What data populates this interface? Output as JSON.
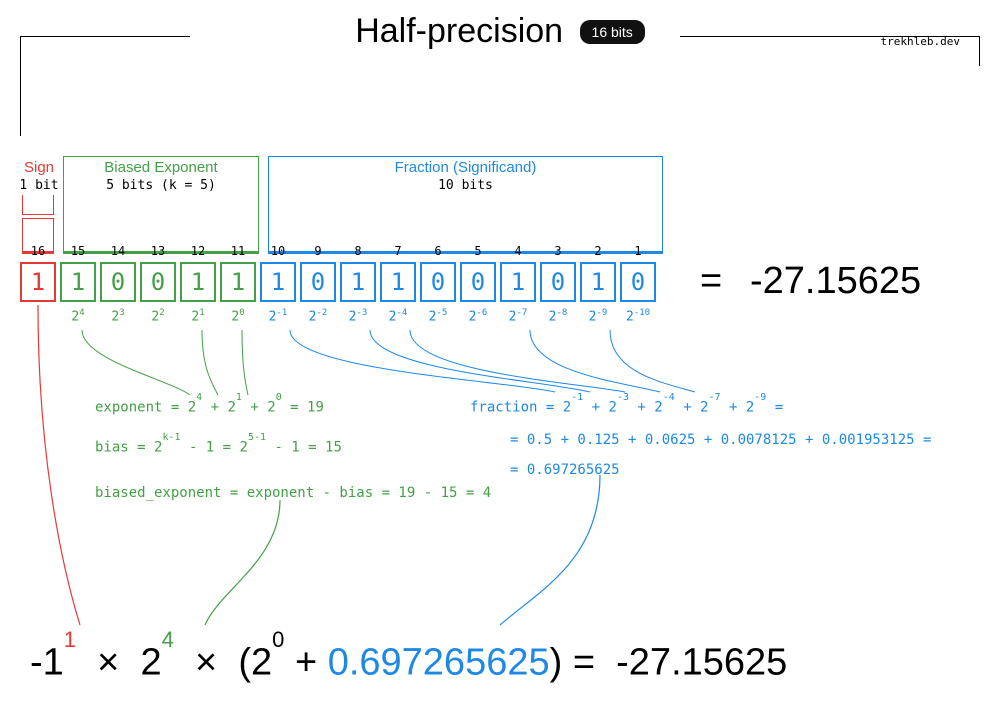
{
  "title": "Half-precision",
  "badge": "16 bits",
  "credit": "trekhleb.dev",
  "sections": {
    "sign": {
      "label": "Sign",
      "sub": "1 bit"
    },
    "exponent": {
      "label": "Biased Exponent",
      "sub": "5 bits (k = 5)"
    },
    "fraction": {
      "label": "Fraction (Significand)",
      "sub": "10 bits"
    }
  },
  "bit_indices": [
    "16",
    "15",
    "14",
    "13",
    "12",
    "11",
    "10",
    "9",
    "8",
    "7",
    "6",
    "5",
    "4",
    "3",
    "2",
    "1"
  ],
  "bits": {
    "sign": [
      "1"
    ],
    "exponent": [
      "1",
      "0",
      "0",
      "1",
      "1"
    ],
    "fraction": [
      "1",
      "0",
      "1",
      "1",
      "0",
      "0",
      "1",
      "0",
      "1",
      "0"
    ]
  },
  "powers": {
    "exponent": [
      "4",
      "3",
      "2",
      "1",
      "0"
    ],
    "fraction": [
      "-1",
      "-2",
      "-3",
      "-4",
      "-5",
      "-6",
      "-7",
      "-8",
      "-9",
      "-10"
    ]
  },
  "result_equals": "=",
  "result_value": "-27.15625",
  "exp_calc": {
    "l1_a": "exponent = 2",
    "l1_b": "+ 2",
    "l1_c": "+ 2",
    "l1_d": " = 19",
    "l1_e4": "4",
    "l1_e1": "1",
    "l1_e0": "0",
    "l2_a": "bias = 2",
    "l2_b": " - 1 = 2",
    "l2_c": " - 1 = 15",
    "l2_e1": "k-1",
    "l2_e2": "5-1",
    "l3": "biased_exponent = exponent - bias = 19 - 15 = 4"
  },
  "frac_calc": {
    "l1_a": "fraction = 2",
    "l1_b": "+ 2",
    "l1_c": "+ 2",
    "l1_d": "+ 2",
    "l1_e": "+ 2",
    "l1_f": " =",
    "e1": "-1",
    "e2": "-3",
    "e3": "-4",
    "e4": "-7",
    "e5": "-9",
    "l2": "= 0.5 + 0.125 + 0.0625 + 0.0078125 + 0.001953125 =",
    "l3": "= 0.697265625"
  },
  "formula": {
    "neg1": "-1",
    "exp1": "1",
    "times1": "×",
    "two": "2",
    "exp4": "4",
    "times2": "×",
    "lpar": "(2",
    "exp0": "0",
    "plus": "+ ",
    "frac": "0.697265625",
    "rpar": ") =",
    "res": "-27.15625"
  }
}
